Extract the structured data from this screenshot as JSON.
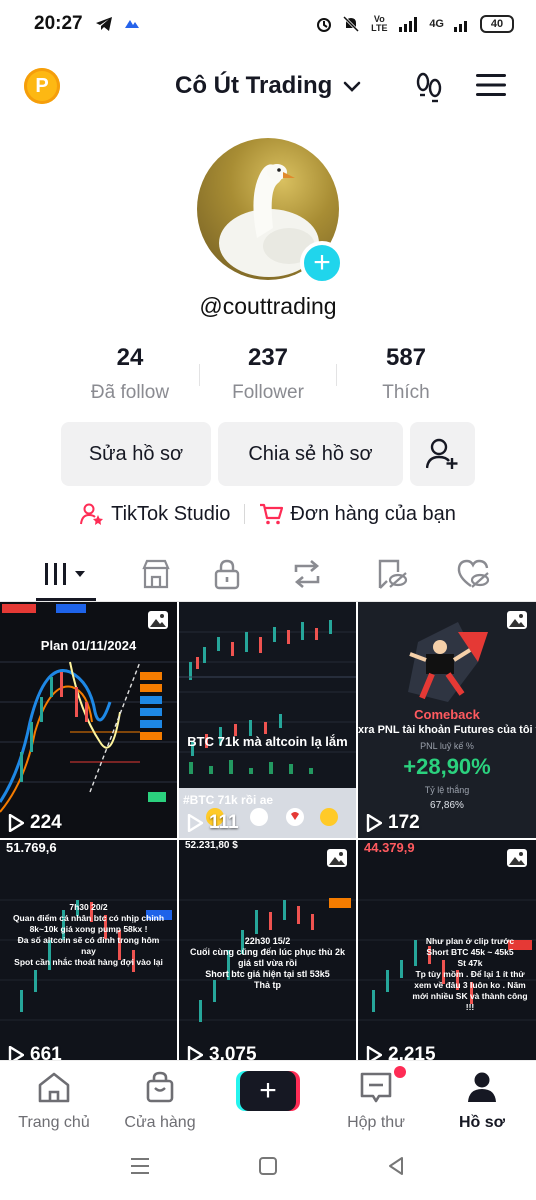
{
  "status_bar": {
    "time": "20:27",
    "network_label": "Vo LTE",
    "signal_label": "4G",
    "battery": "40"
  },
  "header": {
    "account_name": "Cô Út Trading"
  },
  "profile": {
    "username": "@couttrading"
  },
  "stats": [
    {
      "value": "24",
      "label": "Đã follow"
    },
    {
      "value": "237",
      "label": "Follower"
    },
    {
      "value": "587",
      "label": "Thích"
    }
  ],
  "buttons": {
    "edit_profile": "Sửa hồ sơ",
    "share_profile": "Chia sẻ hồ sơ"
  },
  "studio_row": {
    "tiktok_studio": "TikTok Studio",
    "orders": "Đơn hàng của bạn"
  },
  "tabs": [
    "videos",
    "shop",
    "private",
    "reposts",
    "favorites",
    "liked"
  ],
  "videos": [
    {
      "views": "224",
      "caption": "Plan 01/11/2024"
    },
    {
      "views": "111",
      "caption": "BTC 71k mà altcoin lạ lắm",
      "footer": "#BTC 71k rồi ae"
    },
    {
      "views": "172",
      "caption_top": "Comeback",
      "caption_mid": "xra PNL tài khoản Futures của tôi trên B",
      "pnl_label": "PNL luỹ kế %",
      "pnl": "+28,90%",
      "rate_label": "Tỷ lệ thắng",
      "rate": "67,86%"
    },
    {
      "views": "661",
      "price": "51.769,6",
      "caption": "7h30 20/2\nQuan điểm cá nhân btc có nhịp chỉnh 8k~10k giá xong pump 58kx !\nĐa số altcoin sẽ có đỉnh trong hôm nay\nSpot cần nhắc thoát hàng đợi vào lại"
    },
    {
      "views": "3.075",
      "price": "52.231,80 $",
      "caption": "22h30 15/2\nCuối cùng cũng đến lúc phục thù 2k giá stl vừa rồi\nShort btc giá hiện tại stl 53k5\nThả tp"
    },
    {
      "views": "2.215",
      "price": "44.379,9",
      "caption": "Như plan ở clip trước\nShort BTC 45k ~ 45k5\nSt 47k\nTp tùy mồm . Để lại 1 ít thử xem về đâu 3 luôn ko . Năm mới nhiều SK và thành công !!!"
    }
  ],
  "bottom_nav": [
    {
      "label": "Trang chủ"
    },
    {
      "label": "Cửa hàng"
    },
    {
      "label": "Hộp thư"
    },
    {
      "label": "Hồ sơ"
    }
  ],
  "colors": {
    "accent_cyan": "#25f4ee",
    "accent_red": "#fe2c55",
    "profit_green": "#2bd17e"
  }
}
